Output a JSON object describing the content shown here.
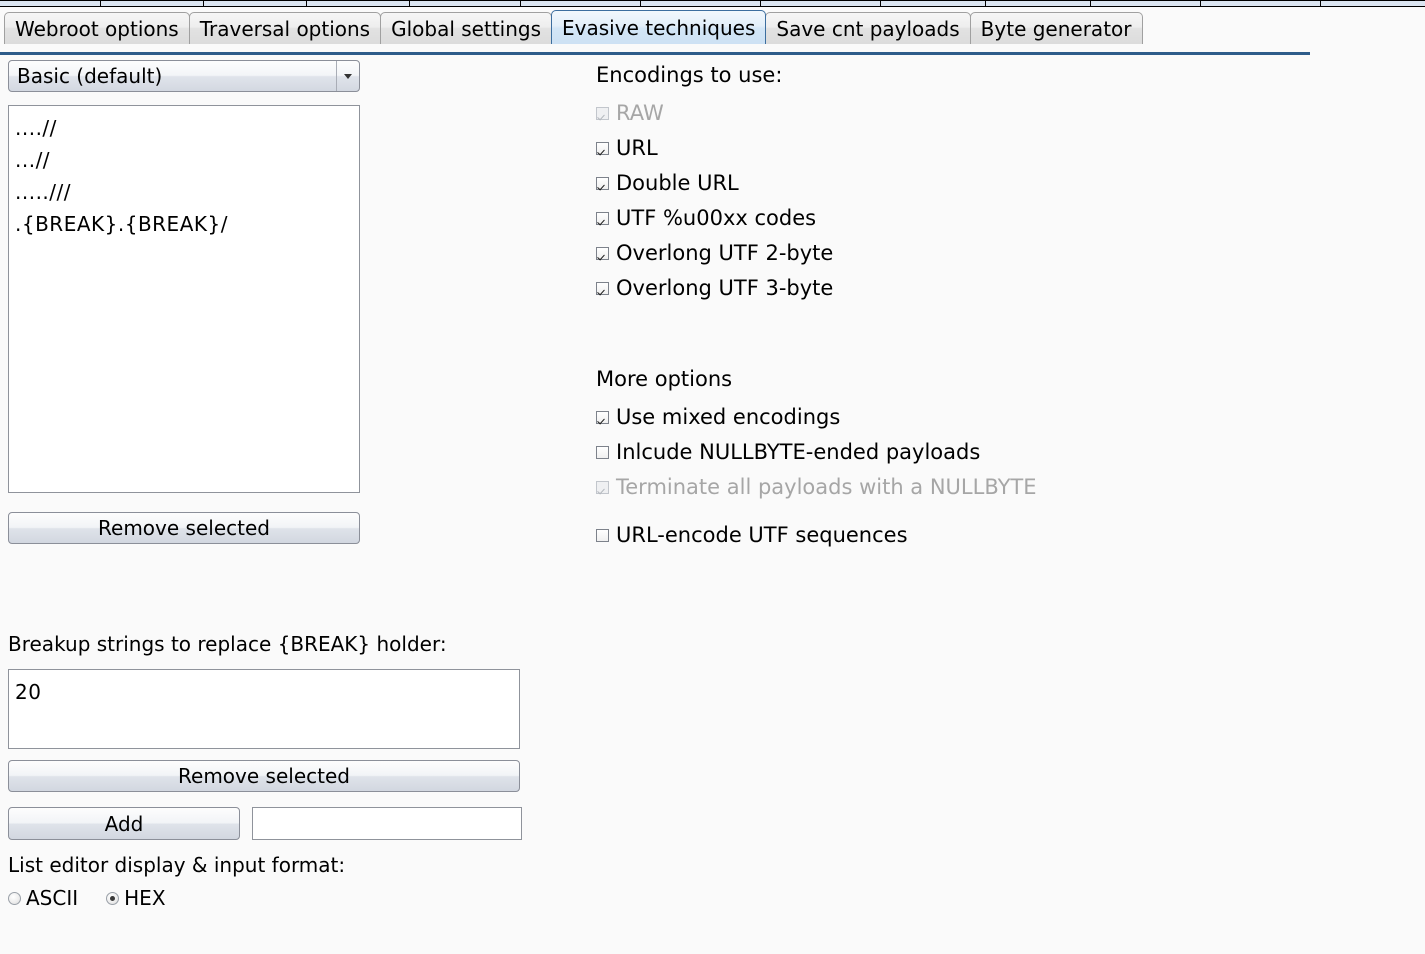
{
  "window": {
    "title": "Evasive techniques",
    "background": "#fafafa",
    "accent": "#2e5c8a"
  },
  "top_strip": {
    "color": "#dbe5f1",
    "divider_positions": [
      100,
      203,
      306,
      409,
      520,
      640,
      760,
      880,
      985,
      1090,
      1200,
      1320
    ]
  },
  "tabs": [
    {
      "label": "Webroot options",
      "selected": false
    },
    {
      "label": "Traversal options",
      "selected": false
    },
    {
      "label": "Global settings",
      "selected": false
    },
    {
      "label": "Evasive techniques",
      "selected": true
    },
    {
      "label": "Save cnt payloads",
      "selected": false
    },
    {
      "label": "Byte generator",
      "selected": false
    }
  ],
  "left_panel": {
    "profile_combo": {
      "value": "Basic (default)",
      "arrow_icon": "chevron-down-icon"
    },
    "traversal_list": {
      "items": [
        "....//",
        "...//",
        "...../// ",
        ".{BREAK}.{BREAK}/"
      ]
    },
    "remove_selected_top_label": "Remove selected",
    "breakup_label": "Breakup strings to replace {BREAK} holder:",
    "breakup_list": {
      "items": [
        "20"
      ]
    },
    "remove_selected_bottom_label": "Remove selected",
    "add_label": "Add",
    "add_input": {
      "value": "",
      "placeholder": ""
    },
    "format_label": "List editor display & input format:",
    "format_options": [
      {
        "label": "ASCII",
        "checked": false
      },
      {
        "label": "HEX",
        "checked": true
      }
    ]
  },
  "right_panel": {
    "encodings_title": "Encodings to use:",
    "encodings": [
      {
        "label": "RAW",
        "checked": true,
        "disabled": true
      },
      {
        "label": "URL",
        "checked": true,
        "disabled": false
      },
      {
        "label": "Double URL",
        "checked": true,
        "disabled": false
      },
      {
        "label": "UTF %u00xx codes",
        "checked": true,
        "disabled": false
      },
      {
        "label": "Overlong UTF 2-byte",
        "checked": true,
        "disabled": false
      },
      {
        "label": "Overlong UTF 3-byte",
        "checked": true,
        "disabled": false
      }
    ],
    "more_options_title": "More options",
    "more_options": [
      {
        "label": "Use mixed encodings",
        "checked": true,
        "disabled": false
      },
      {
        "label": "Inlcude NULLBYTE-ended payloads",
        "checked": false,
        "disabled": false
      },
      {
        "label": "Terminate all payloads with a NULLBYTE",
        "checked": true,
        "disabled": true
      }
    ],
    "url_encode_option": {
      "label": "URL-encode UTF sequences",
      "checked": false,
      "disabled": false
    }
  }
}
